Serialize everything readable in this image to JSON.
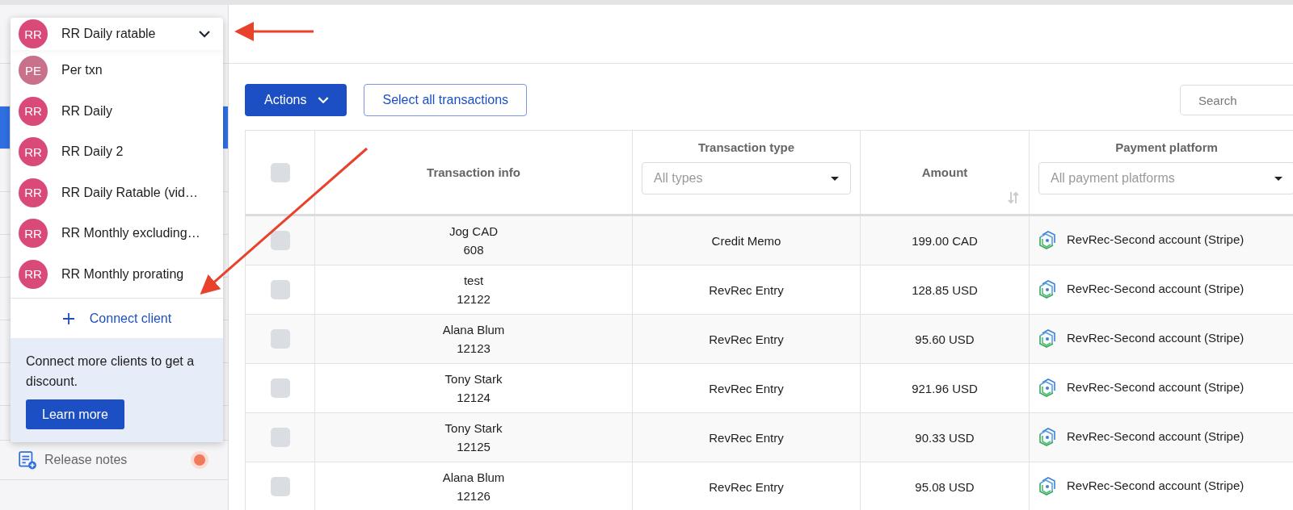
{
  "client_menu": {
    "current": {
      "initials": "RR",
      "name": "RR Daily ratable",
      "color": "#d94a78"
    },
    "items": [
      {
        "initials": "PE",
        "name": "Per txn",
        "color": "#c9708a"
      },
      {
        "initials": "RR",
        "name": "RR Daily",
        "color": "#d94a78"
      },
      {
        "initials": "RR",
        "name": "RR Daily 2",
        "color": "#d94a78"
      },
      {
        "initials": "RR",
        "name": "RR Daily Ratable (vid…",
        "color": "#d94a78"
      },
      {
        "initials": "RR",
        "name": "RR Monthly excluding…",
        "color": "#d94a78"
      },
      {
        "initials": "RR",
        "name": "RR Monthly prorating",
        "color": "#d94a78"
      }
    ],
    "connect_label": "Connect client",
    "promo": {
      "text": "Connect more clients to get a discount.",
      "button": "Learn more"
    }
  },
  "sidebar": {
    "release_notes": {
      "label": "Release notes",
      "unread": true
    }
  },
  "toolbar": {
    "actions": "Actions",
    "select_all": "Select all transactions",
    "search_placeholder": "Search"
  },
  "table": {
    "select_all_checked": false,
    "columns": [
      {
        "label": "Transaction info"
      },
      {
        "label": "Transaction type",
        "filter": "All types"
      },
      {
        "label": "Amount",
        "sortable": true
      },
      {
        "label": "Payment platform",
        "filter": "All payment platforms"
      }
    ],
    "rows": [
      {
        "checked": false,
        "name": "Jog CAD",
        "number": "608",
        "type": "Credit Memo",
        "amount": "199.00 CAD",
        "platform": "RevRec-Second account (Stripe)"
      },
      {
        "checked": false,
        "name": "test",
        "number": "12122",
        "type": "RevRec Entry",
        "amount": "128.85 USD",
        "platform": "RevRec-Second account (Stripe)"
      },
      {
        "checked": false,
        "name": "Alana Blum",
        "number": "12123",
        "type": "RevRec Entry",
        "amount": "95.60 USD",
        "platform": "RevRec-Second account (Stripe)"
      },
      {
        "checked": false,
        "name": "Tony Stark",
        "number": "12124",
        "type": "RevRec Entry",
        "amount": "921.96 USD",
        "platform": "RevRec-Second account (Stripe)"
      },
      {
        "checked": false,
        "name": "Tony Stark",
        "number": "12125",
        "type": "RevRec Entry",
        "amount": "90.33 USD",
        "platform": "RevRec-Second account (Stripe)"
      },
      {
        "checked": false,
        "name": "Alana Blum",
        "number": "12126",
        "type": "RevRec Entry",
        "amount": "95.08 USD",
        "platform": "RevRec-Second account (Stripe)"
      }
    ]
  }
}
